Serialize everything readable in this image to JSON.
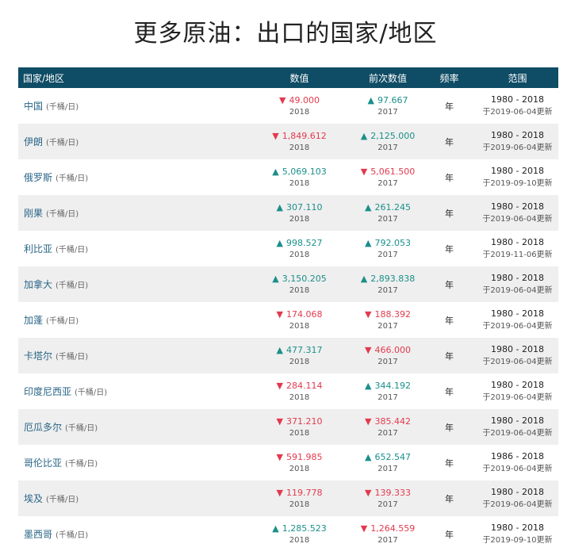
{
  "page": {
    "title": "更多原油：出口的国家/地区"
  },
  "table": {
    "headers": {
      "country": "国家/地区",
      "value": "数值",
      "previous": "前次数值",
      "frequency": "频率",
      "range": "范围"
    },
    "rows": [
      {
        "country": "中国",
        "unit": "(千桶/日)",
        "value": "49.000",
        "value_dir": "down",
        "value_year": "2018",
        "prev": "97.667",
        "prev_dir": "up",
        "prev_year": "2017",
        "freq": "年",
        "range": "1980 - 2018",
        "updated": "于2019-06-04更新"
      },
      {
        "country": "伊朗",
        "unit": "(千桶/日)",
        "value": "1,849.612",
        "value_dir": "down",
        "value_year": "2018",
        "prev": "2,125.000",
        "prev_dir": "up",
        "prev_year": "2017",
        "freq": "年",
        "range": "1980 - 2018",
        "updated": "于2019-06-04更新"
      },
      {
        "country": "俄罗斯",
        "unit": "(千桶/日)",
        "value": "5,069.103",
        "value_dir": "up",
        "value_year": "2018",
        "prev": "5,061.500",
        "prev_dir": "down",
        "prev_year": "2017",
        "freq": "年",
        "range": "1980 - 2018",
        "updated": "于2019-09-10更新"
      },
      {
        "country": "刚果",
        "unit": "(千桶/日)",
        "value": "307.110",
        "value_dir": "up",
        "value_year": "2018",
        "prev": "261.245",
        "prev_dir": "up",
        "prev_year": "2017",
        "freq": "年",
        "range": "1980 - 2018",
        "updated": "于2019-06-04更新"
      },
      {
        "country": "利比亚",
        "unit": "(千桶/日)",
        "value": "998.527",
        "value_dir": "up",
        "value_year": "2018",
        "prev": "792.053",
        "prev_dir": "up",
        "prev_year": "2017",
        "freq": "年",
        "range": "1980 - 2018",
        "updated": "于2019-11-06更新"
      },
      {
        "country": "加拿大",
        "unit": "(千桶/日)",
        "value": "3,150.205",
        "value_dir": "up",
        "value_year": "2018",
        "prev": "2,893.838",
        "prev_dir": "up",
        "prev_year": "2017",
        "freq": "年",
        "range": "1980 - 2018",
        "updated": "于2019-06-04更新"
      },
      {
        "country": "加蓬",
        "unit": "(千桶/日)",
        "value": "174.068",
        "value_dir": "down",
        "value_year": "2018",
        "prev": "188.392",
        "prev_dir": "down",
        "prev_year": "2017",
        "freq": "年",
        "range": "1980 - 2018",
        "updated": "于2019-06-04更新"
      },
      {
        "country": "卡塔尔",
        "unit": "(千桶/日)",
        "value": "477.317",
        "value_dir": "up",
        "value_year": "2018",
        "prev": "466.000",
        "prev_dir": "down",
        "prev_year": "2017",
        "freq": "年",
        "range": "1980 - 2018",
        "updated": "于2019-06-04更新"
      },
      {
        "country": "印度尼西亚",
        "unit": "(千桶/日)",
        "value": "284.114",
        "value_dir": "down",
        "value_year": "2018",
        "prev": "344.192",
        "prev_dir": "up",
        "prev_year": "2017",
        "freq": "年",
        "range": "1980 - 2018",
        "updated": "于2019-06-04更新"
      },
      {
        "country": "厄瓜多尔",
        "unit": "(千桶/日)",
        "value": "371.210",
        "value_dir": "down",
        "value_year": "2018",
        "prev": "385.442",
        "prev_dir": "down",
        "prev_year": "2017",
        "freq": "年",
        "range": "1980 - 2018",
        "updated": "于2019-06-04更新"
      },
      {
        "country": "哥伦比亚",
        "unit": "(千桶/日)",
        "value": "591.985",
        "value_dir": "down",
        "value_year": "2018",
        "prev": "652.547",
        "prev_dir": "up",
        "prev_year": "2017",
        "freq": "年",
        "range": "1986 - 2018",
        "updated": "于2019-06-04更新"
      },
      {
        "country": "埃及",
        "unit": "(千桶/日)",
        "value": "119.778",
        "value_dir": "down",
        "value_year": "2018",
        "prev": "139.333",
        "prev_dir": "down",
        "prev_year": "2017",
        "freq": "年",
        "range": "1980 - 2018",
        "updated": "于2019-06-04更新"
      },
      {
        "country": "墨西哥",
        "unit": "(千桶/日)",
        "value": "1,285.523",
        "value_dir": "up",
        "value_year": "2018",
        "prev": "1,264.559",
        "prev_dir": "down",
        "prev_year": "2017",
        "freq": "年",
        "range": "1980 - 2018",
        "updated": "于2019-09-10更新"
      }
    ]
  },
  "colors": {
    "header_bg": "#0f4c65",
    "down": "#e23a4e",
    "up": "#1b8f8a",
    "link": "#2a6687"
  },
  "icons": {
    "up": "triangle-up-icon",
    "down": "triangle-down-icon"
  }
}
